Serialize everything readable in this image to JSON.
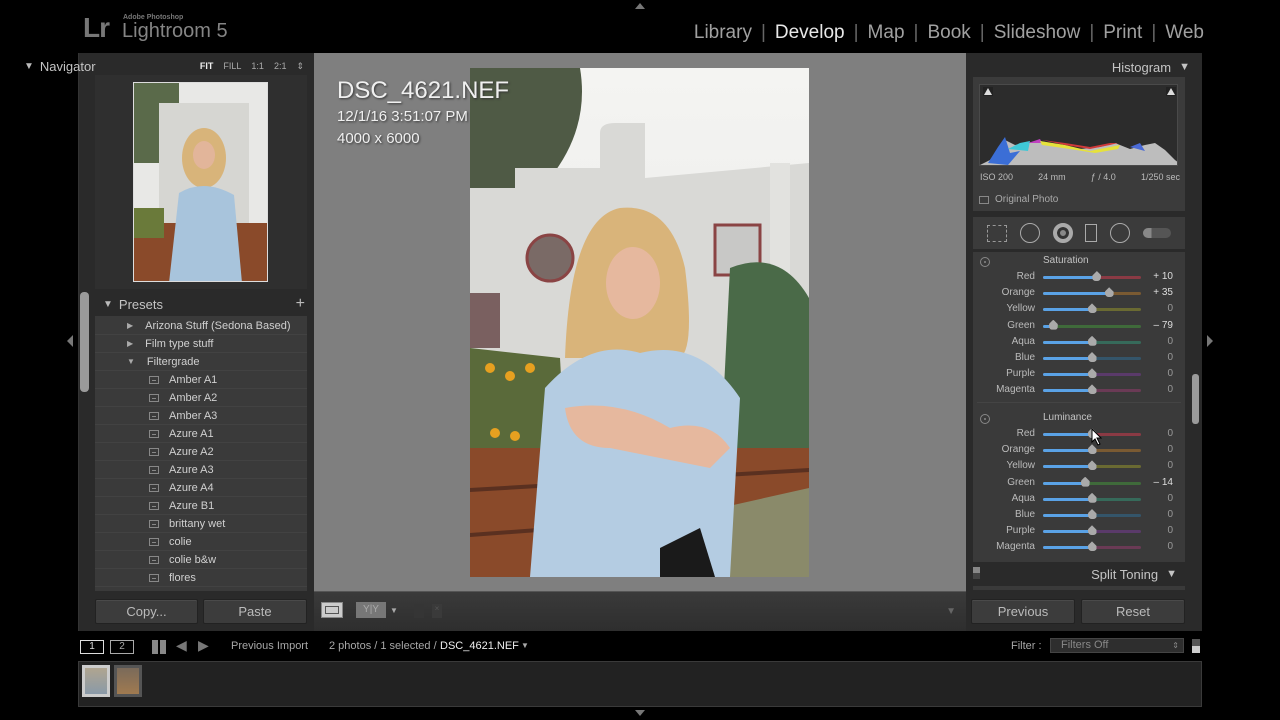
{
  "app": {
    "brand_mark": "Lr",
    "brand_small": "Adobe Photoshop",
    "brand_name": "Lightroom 5"
  },
  "modules": [
    {
      "label": "Library",
      "active": false
    },
    {
      "label": "Develop",
      "active": true
    },
    {
      "label": "Map",
      "active": false
    },
    {
      "label": "Book",
      "active": false
    },
    {
      "label": "Slideshow",
      "active": false
    },
    {
      "label": "Print",
      "active": false
    },
    {
      "label": "Web",
      "active": false
    }
  ],
  "navigator": {
    "title": "Navigator",
    "zoom_options": [
      "FIT",
      "FILL",
      "1:1",
      "2:1"
    ],
    "selected_zoom": "FIT"
  },
  "presets": {
    "title": "Presets",
    "add_icon": "+",
    "folders": [
      {
        "label": "Arizona Stuff (Sedona Based)",
        "expanded": false
      },
      {
        "label": "Film type stuff",
        "expanded": false
      },
      {
        "label": "Filtergrade",
        "expanded": true
      }
    ],
    "items": [
      "Amber A1",
      "Amber A2",
      "Amber A3",
      "Azure A1",
      "Azure A2",
      "Azure A3",
      "Azure A4",
      "Azure B1",
      "brittany wet",
      "colie",
      "colie b&w",
      "flores"
    ]
  },
  "left_buttons": {
    "copy": "Copy...",
    "paste": "Paste"
  },
  "photo_info": {
    "filename": "DSC_4621.NEF",
    "datetime": "12/1/16 3:51:07 PM",
    "dimensions": "4000 x 6000"
  },
  "histogram": {
    "title": "Histogram",
    "iso": "ISO 200",
    "focal_length": "24 mm",
    "aperture": "ƒ / 4.0",
    "shutter": "1/250 sec",
    "original_photo_label": "Original Photo"
  },
  "tools": [
    "crop-overlay",
    "spot-removal",
    "red-eye-correction",
    "graduated-filter",
    "radial-filter",
    "adjustment-brush"
  ],
  "hsl": {
    "saturation": {
      "title": "Saturation",
      "rows": [
        {
          "label": "Red",
          "value": 10,
          "display": "+ 10",
          "color": "#8a3a44"
        },
        {
          "label": "Orange",
          "value": 35,
          "display": "+ 35",
          "color": "#7a5a32"
        },
        {
          "label": "Yellow",
          "value": 0,
          "display": "0",
          "color": "#6a6a32"
        },
        {
          "label": "Green",
          "value": -79,
          "display": "– 79",
          "color": "#3f6a3a"
        },
        {
          "label": "Aqua",
          "value": 0,
          "display": "0",
          "color": "#366a5a"
        },
        {
          "label": "Blue",
          "value": 0,
          "display": "0",
          "color": "#34556a"
        },
        {
          "label": "Purple",
          "value": 0,
          "display": "0",
          "color": "#5a3a6a"
        },
        {
          "label": "Magenta",
          "value": 0,
          "display": "0",
          "color": "#6a3a55"
        }
      ]
    },
    "luminance": {
      "title": "Luminance",
      "rows": [
        {
          "label": "Red",
          "value": 0,
          "display": "0",
          "color": "#8a3a44"
        },
        {
          "label": "Orange",
          "value": 0,
          "display": "0",
          "color": "#7a5a32"
        },
        {
          "label": "Yellow",
          "value": 0,
          "display": "0",
          "color": "#6a6a32"
        },
        {
          "label": "Green",
          "value": -14,
          "display": "– 14",
          "color": "#3f6a3a"
        },
        {
          "label": "Aqua",
          "value": 0,
          "display": "0",
          "color": "#366a5a"
        },
        {
          "label": "Blue",
          "value": 0,
          "display": "0",
          "color": "#34556a"
        },
        {
          "label": "Purple",
          "value": 0,
          "display": "0",
          "color": "#5a3a6a"
        },
        {
          "label": "Magenta",
          "value": 0,
          "display": "0",
          "color": "#6a3a55"
        }
      ]
    }
  },
  "split_toning": {
    "title": "Split Toning"
  },
  "right_buttons": {
    "previous": "Previous",
    "reset": "Reset"
  },
  "filmstrip": {
    "page1": "1",
    "page2": "2",
    "source": "Previous Import",
    "count": "2 photos / 1 selected /",
    "selected_file": "DSC_4621.NEF",
    "filter_label": "Filter :",
    "filter_value": "Filters Off"
  },
  "colors": {
    "slider_fill": "#5aa2e6",
    "panel_bg": "#2a2a2a",
    "canvas_bg": "#7f7f7f"
  }
}
